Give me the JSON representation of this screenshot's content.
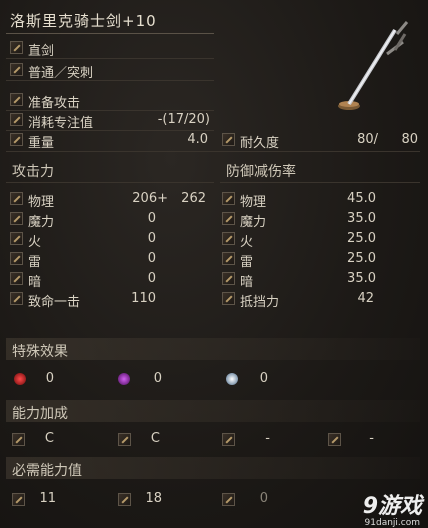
{
  "title": "洛斯里克骑士剑+10",
  "weapon": {
    "type": "直剑",
    "attack_type": "普通／突刺",
    "skill": "准备攻击",
    "fp_label": "消耗专注值",
    "fp_value": "-(17/20)",
    "weight_label": "重量",
    "weight_value": "4.0",
    "durability_label": "耐久度",
    "durability_current": "80/",
    "durability_max": "80"
  },
  "attack": {
    "header": "攻击力",
    "rows": [
      {
        "label": "物理",
        "value": "206+",
        "extra": "262",
        "icon": "sword-icon"
      },
      {
        "label": "魔力",
        "value": "0",
        "icon": "magic-icon"
      },
      {
        "label": "火",
        "value": "0",
        "icon": "fire-icon"
      },
      {
        "label": "雷",
        "value": "0",
        "icon": "lightning-icon"
      },
      {
        "label": "暗",
        "value": "0",
        "icon": "dark-icon"
      },
      {
        "label": "致命一击",
        "value": "110",
        "icon": "critical-icon"
      }
    ]
  },
  "defense": {
    "header": "防御减伤率",
    "rows": [
      {
        "label": "物理",
        "value": "45.0",
        "icon": "shield-icon"
      },
      {
        "label": "魔力",
        "value": "35.0",
        "icon": "magic-shield-icon"
      },
      {
        "label": "火",
        "value": "25.0",
        "icon": "fire-shield-icon"
      },
      {
        "label": "雷",
        "value": "25.0",
        "icon": "lightning-shield-icon"
      },
      {
        "label": "暗",
        "value": "35.0",
        "icon": "dark-shield-icon"
      },
      {
        "label": "抵挡力",
        "value": "42",
        "icon": "stability-icon"
      }
    ]
  },
  "special": {
    "header": "特殊效果",
    "values": [
      "0",
      "0",
      "0"
    ],
    "colors": [
      "#b01818",
      "#9a2fb0",
      "#e8f4ff"
    ]
  },
  "scaling": {
    "header": "能力加成",
    "values": [
      "C",
      "C",
      "-",
      "-"
    ]
  },
  "requirements": {
    "header": "必需能力值",
    "values": [
      "11",
      "18",
      "0"
    ]
  },
  "watermark": {
    "logo": "9游戏",
    "site": "91danji.com"
  }
}
